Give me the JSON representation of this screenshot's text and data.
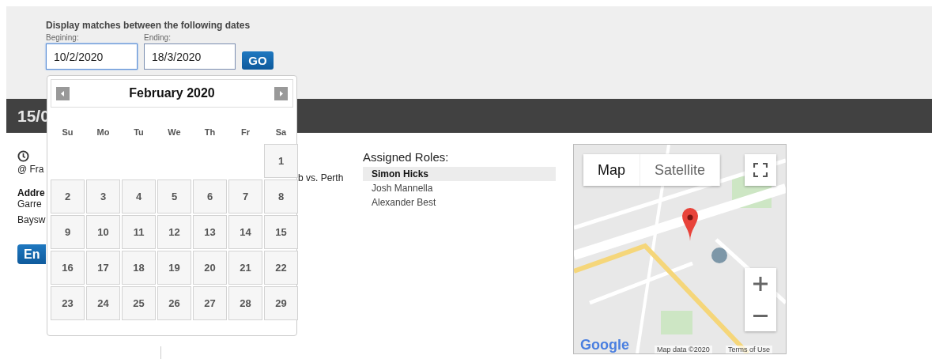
{
  "filter": {
    "title": "Display matches between the following dates",
    "beginning": {
      "label": "Begining:",
      "value": "10/2/2020",
      "focused": true
    },
    "ending": {
      "label": "Ending:",
      "value": "18/3/2020",
      "focused": false
    },
    "go_button": "GO"
  },
  "match_bar": {
    "title": "15/0"
  },
  "details": {
    "venue": "@ Fra",
    "address_label": "Addre",
    "address_lines": [
      "Garre",
      "Baysw"
    ],
    "button": "En",
    "teams": "b vs. Perth"
  },
  "roles": {
    "title": "Assigned Roles:",
    "people": [
      {
        "name": "Simon Hicks",
        "selected": true
      },
      {
        "name": "Josh Mannella",
        "selected": false
      },
      {
        "name": "Alexander Best",
        "selected": false
      }
    ]
  },
  "map": {
    "kind": "picture",
    "types": [
      {
        "label": "Map",
        "selected": true
      },
      {
        "label": "Satellite",
        "selected": false
      }
    ],
    "logo": "Google",
    "attribution": "Map data ©2020",
    "terms": "Terms of Use"
  },
  "calendar": {
    "title": "February 2020",
    "weekdays": [
      "Su",
      "Mo",
      "Tu",
      "We",
      "Th",
      "Fr",
      "Sa"
    ],
    "weeks": [
      [
        "1"
      ],
      [
        "2",
        "3",
        "4",
        "5",
        "6",
        "7",
        "8"
      ],
      [
        "9",
        "10",
        "11",
        "12",
        "13",
        "14",
        "15"
      ],
      [
        "16",
        "17",
        "18",
        "19",
        "20",
        "21",
        "22"
      ],
      [
        "23",
        "24",
        "25",
        "26",
        "27",
        "28",
        "29"
      ]
    ]
  }
}
